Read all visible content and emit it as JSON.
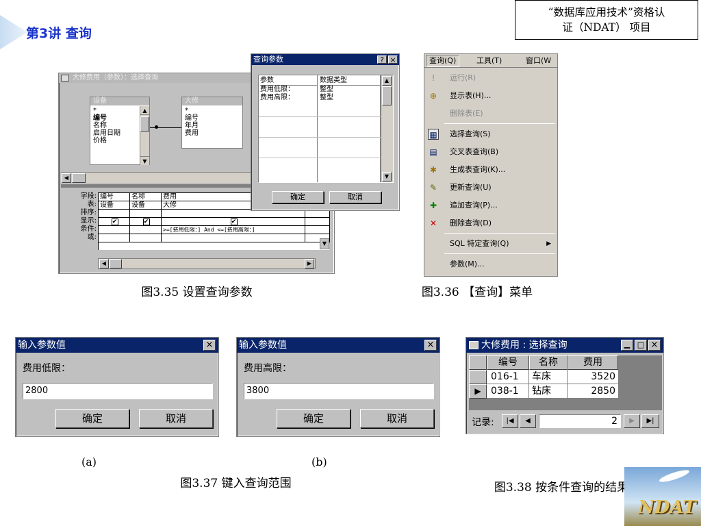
{
  "header": {
    "lecture_title": "第3讲  查询",
    "course_line1": "“数据库应用技术”资格认",
    "course_line2": "证（NDAT）  项目"
  },
  "fig35": {
    "design_title": "大修费用（参数）：选择查询",
    "table1": {
      "title": "设备",
      "fields": [
        "*",
        "编号",
        "名称",
        "启用日期",
        "价格"
      ]
    },
    "table2": {
      "title": "大修",
      "fields": [
        "*",
        "编号",
        "年月",
        "费用"
      ]
    },
    "grid_row_labels": [
      "字段:",
      "表:",
      "排序:",
      "显示:",
      "条件:",
      "或:"
    ],
    "grid_fields": [
      "编号",
      "名称",
      "费用"
    ],
    "grid_tables": [
      "设备",
      "设备",
      "大修"
    ],
    "condition": ">=[费用低限：] And <=[费用高限：]",
    "params_dialog": {
      "title": "查询参数",
      "help": "?",
      "close": "×",
      "col_param": "参数",
      "col_type": "数据类型",
      "rows": [
        {
          "p": "费用低限：",
          "t": "整型"
        },
        {
          "p": "费用高限：",
          "t": "整型"
        }
      ],
      "ok": "确定",
      "cancel": "取消"
    },
    "caption": "图3.35   设置查询参数"
  },
  "fig36": {
    "menubar": [
      "查询(Q)",
      "工具(T)",
      "窗口(W"
    ],
    "items": [
      {
        "label": "运行(R)",
        "icon": "!",
        "disabled": true
      },
      {
        "label": "显示表(H)...",
        "icon": "⊕",
        "disabled": false
      },
      {
        "label": "删除表(E)",
        "icon": "",
        "disabled": true
      },
      {
        "label": "选择查询(S)",
        "icon": "▦",
        "disabled": false
      },
      {
        "label": "交叉表查询(B)",
        "icon": "▤",
        "disabled": false
      },
      {
        "label": "生成表查询(K)...",
        "icon": "✱",
        "disabled": false
      },
      {
        "label": "更新查询(U)",
        "icon": "✎",
        "disabled": false
      },
      {
        "label": "追加查询(P)...",
        "icon": "✚",
        "disabled": false
      },
      {
        "label": "删除查询(D)",
        "icon": "✕",
        "disabled": false
      },
      {
        "label": "SQL 特定查询(Q)",
        "icon": "",
        "disabled": false,
        "submenu": "▶"
      },
      {
        "label": "参数(M)...",
        "icon": "",
        "disabled": false
      }
    ],
    "caption": "图3.36   【查询】菜单"
  },
  "fig37": {
    "dialog_a": {
      "title": "输入参数值",
      "prompt": "费用低限：",
      "value": "2800",
      "ok": "确定",
      "cancel": "取消",
      "close": "×"
    },
    "dialog_b": {
      "title": "输入参数值",
      "prompt": "费用高限：",
      "value": "3800",
      "ok": "确定",
      "cancel": "取消",
      "close": "×"
    },
    "label_a": "(a)",
    "label_b": "(b)",
    "caption": "图3.37   键入查询范围"
  },
  "fig38": {
    "title": "大修费用 : 选择查询",
    "columns": [
      "编号",
      "名称",
      "费用"
    ],
    "rows": [
      [
        "016-1",
        "车床",
        "3520"
      ],
      [
        "038-1",
        "钻床",
        "2850"
      ]
    ],
    "record_label": "记录:",
    "record_value": "2",
    "caption": "图3.38   按条件查询的结果"
  },
  "logo_text": "NDAT",
  "colors": {
    "title_blue": "#1a33cc",
    "titlebar_blue": "#0a246a",
    "win_gray": "#c0c0c0"
  }
}
